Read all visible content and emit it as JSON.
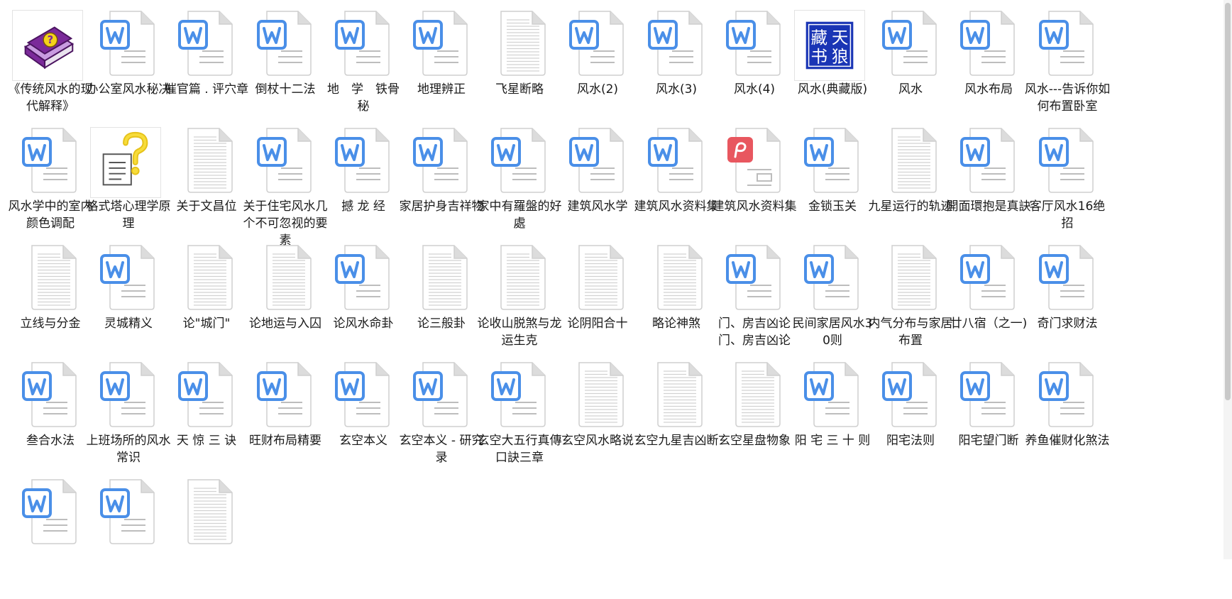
{
  "colors": {
    "word_blue": "#4a8fe8",
    "page_fold": "#dcdcdc",
    "pdf_red": "#e8575f",
    "chm_purple": "#7b2a9a",
    "tianlang_blue": "#1a35b5"
  },
  "files": [
    {
      "name": "《传统风水的现代解释》",
      "icon": "chm-book-icon"
    },
    {
      "name": "办公室风水秘决",
      "icon": "word-doc-icon"
    },
    {
      "name": "催官篇 . 评穴章",
      "icon": "word-doc-icon"
    },
    {
      "name": "倒杖十二法",
      "icon": "word-doc-icon"
    },
    {
      "name": "地　学　铁骨　秘",
      "icon": "word-doc-icon"
    },
    {
      "name": "地理辨正",
      "icon": "word-doc-icon"
    },
    {
      "name": "飞星断略",
      "icon": "text-doc-icon"
    },
    {
      "name": "风水(2)",
      "icon": "word-doc-icon"
    },
    {
      "name": "风水(3)",
      "icon": "word-doc-icon"
    },
    {
      "name": "风水(4)",
      "icon": "word-doc-icon"
    },
    {
      "name": "风水(典藏版)",
      "icon": "tianlang-logo-icon",
      "logo_text": [
        "藏",
        "天",
        "书",
        "狼"
      ]
    },
    {
      "name": "风水",
      "icon": "word-doc-icon"
    },
    {
      "name": "风水布局",
      "icon": "word-doc-icon"
    },
    {
      "name": "风水---告诉你如何布置卧室",
      "icon": "word-doc-icon"
    },
    {
      "name": "风水学中的室内颜色调配",
      "icon": "word-doc-icon"
    },
    {
      "name": "格式塔心理学原理",
      "icon": "help-question-icon"
    },
    {
      "name": "关于文昌位",
      "icon": "text-doc-icon"
    },
    {
      "name": "关于住宅风水几个不可忽视的要素",
      "icon": "word-doc-icon"
    },
    {
      "name": "撼 龙 经",
      "icon": "word-doc-icon"
    },
    {
      "name": "家居护身吉祥物",
      "icon": "word-doc-icon"
    },
    {
      "name": "家中有羅盤的好處",
      "icon": "word-doc-icon"
    },
    {
      "name": "建筑风水学",
      "icon": "word-doc-icon"
    },
    {
      "name": "建筑风水资料集",
      "icon": "word-doc-icon"
    },
    {
      "name": "建筑风水资料集",
      "icon": "pdf-doc-icon"
    },
    {
      "name": "金锁玉关",
      "icon": "word-doc-icon"
    },
    {
      "name": "九星运行的轨迹",
      "icon": "text-doc-icon"
    },
    {
      "name": "開面環抱是真訣",
      "icon": "word-doc-icon"
    },
    {
      "name": "客厅风水16绝招",
      "icon": "word-doc-icon"
    },
    {
      "name": "立线与分金",
      "icon": "text-doc-icon"
    },
    {
      "name": "灵城精义",
      "icon": "word-doc-icon"
    },
    {
      "name": "论\"城门\"",
      "icon": "text-doc-icon"
    },
    {
      "name": "论地运与入囚",
      "icon": "text-doc-icon"
    },
    {
      "name": "论风水命卦",
      "icon": "word-doc-icon"
    },
    {
      "name": "论三般卦",
      "icon": "text-doc-icon"
    },
    {
      "name": "论收山脱煞与龙运生克",
      "icon": "text-doc-icon"
    },
    {
      "name": "论阴阳合十",
      "icon": "text-doc-icon"
    },
    {
      "name": "略论神煞",
      "icon": "text-doc-icon"
    },
    {
      "name": "门、房吉凶论门、房吉凶论",
      "icon": "word-doc-icon"
    },
    {
      "name": "民间家居风水30则",
      "icon": "word-doc-icon"
    },
    {
      "name": "内气分布与家居布置",
      "icon": "text-doc-icon"
    },
    {
      "name": "廿八宿（之一)",
      "icon": "word-doc-icon"
    },
    {
      "name": "奇门求财法",
      "icon": "word-doc-icon"
    },
    {
      "name": "叁合水法",
      "icon": "word-doc-icon"
    },
    {
      "name": "上班场所的风水常识",
      "icon": "word-doc-icon"
    },
    {
      "name": "天 惊 三 诀",
      "icon": "word-doc-icon"
    },
    {
      "name": "旺财布局精要",
      "icon": "word-doc-icon"
    },
    {
      "name": "玄空本义",
      "icon": "word-doc-icon"
    },
    {
      "name": "玄空本义 - 研究录",
      "icon": "word-doc-icon"
    },
    {
      "name": "玄空大五行真傳口訣三章",
      "icon": "word-doc-icon"
    },
    {
      "name": "玄空风水略说",
      "icon": "text-doc-icon"
    },
    {
      "name": "玄空九星吉凶断",
      "icon": "text-doc-icon"
    },
    {
      "name": "玄空星盘物象",
      "icon": "text-doc-icon"
    },
    {
      "name": "阳 宅 三 十 则",
      "icon": "word-doc-icon"
    },
    {
      "name": "阳宅法则",
      "icon": "word-doc-icon"
    },
    {
      "name": "阳宅望门断",
      "icon": "word-doc-icon"
    },
    {
      "name": "养鱼催财化煞法",
      "icon": "word-doc-icon"
    },
    {
      "name": "",
      "icon": "word-doc-icon"
    },
    {
      "name": "",
      "icon": "word-doc-icon"
    },
    {
      "name": "",
      "icon": "text-doc-icon"
    }
  ]
}
